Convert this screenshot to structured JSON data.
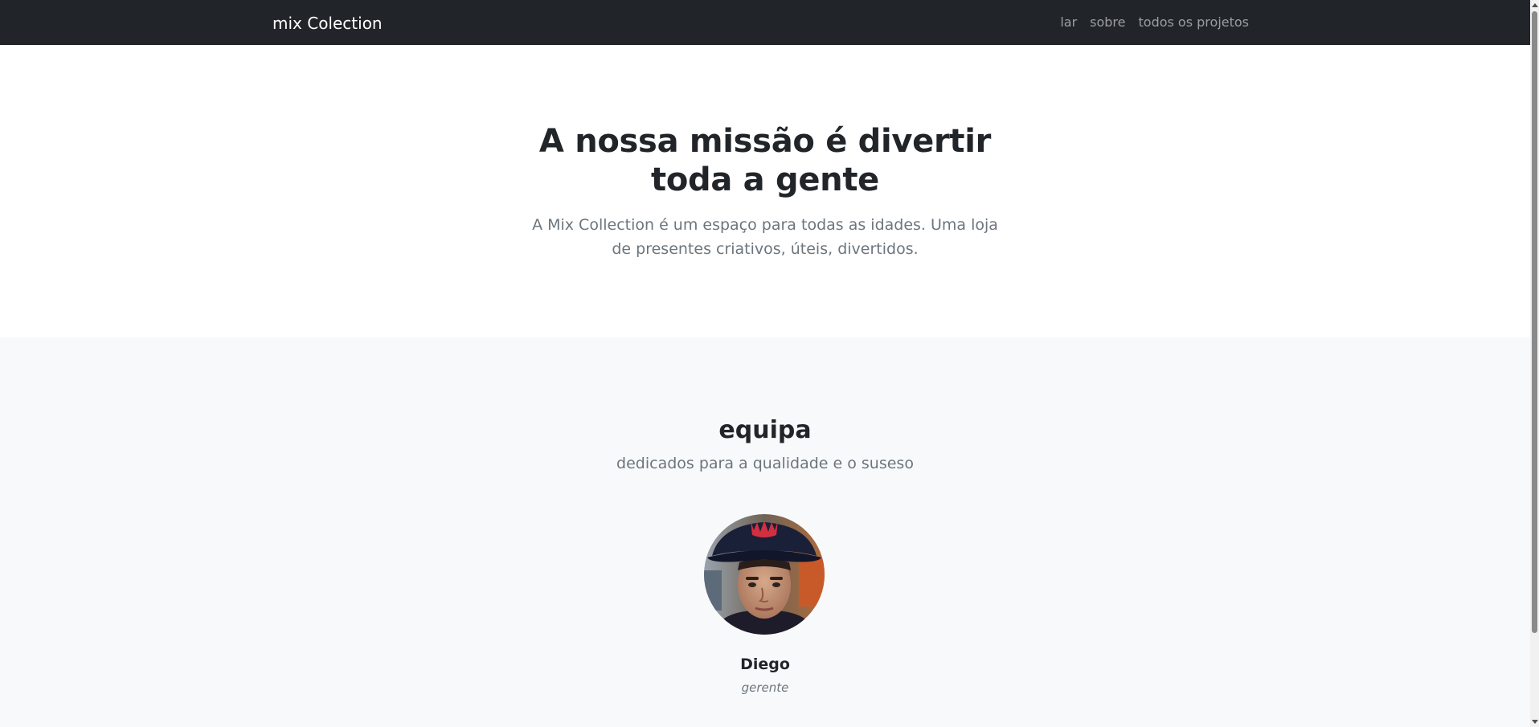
{
  "navbar": {
    "brand": "mix Colection",
    "links": [
      "lar",
      "sobre",
      "todos os projetos"
    ]
  },
  "hero": {
    "title": "A nossa missão é divertir toda a gente",
    "lead": "A Mix Collection é um espaço para todas as idades. Uma loja de presentes criativos, úteis, divertidos."
  },
  "team": {
    "title": "equipa",
    "subtitle": "dedicados para a qualidade e o suseso",
    "members": [
      {
        "name": "Diego",
        "role": "gerente"
      }
    ]
  },
  "colors": {
    "navbar_bg": "#212529",
    "section_bg": "#f8f9fa",
    "muted_text": "#6c757d"
  }
}
